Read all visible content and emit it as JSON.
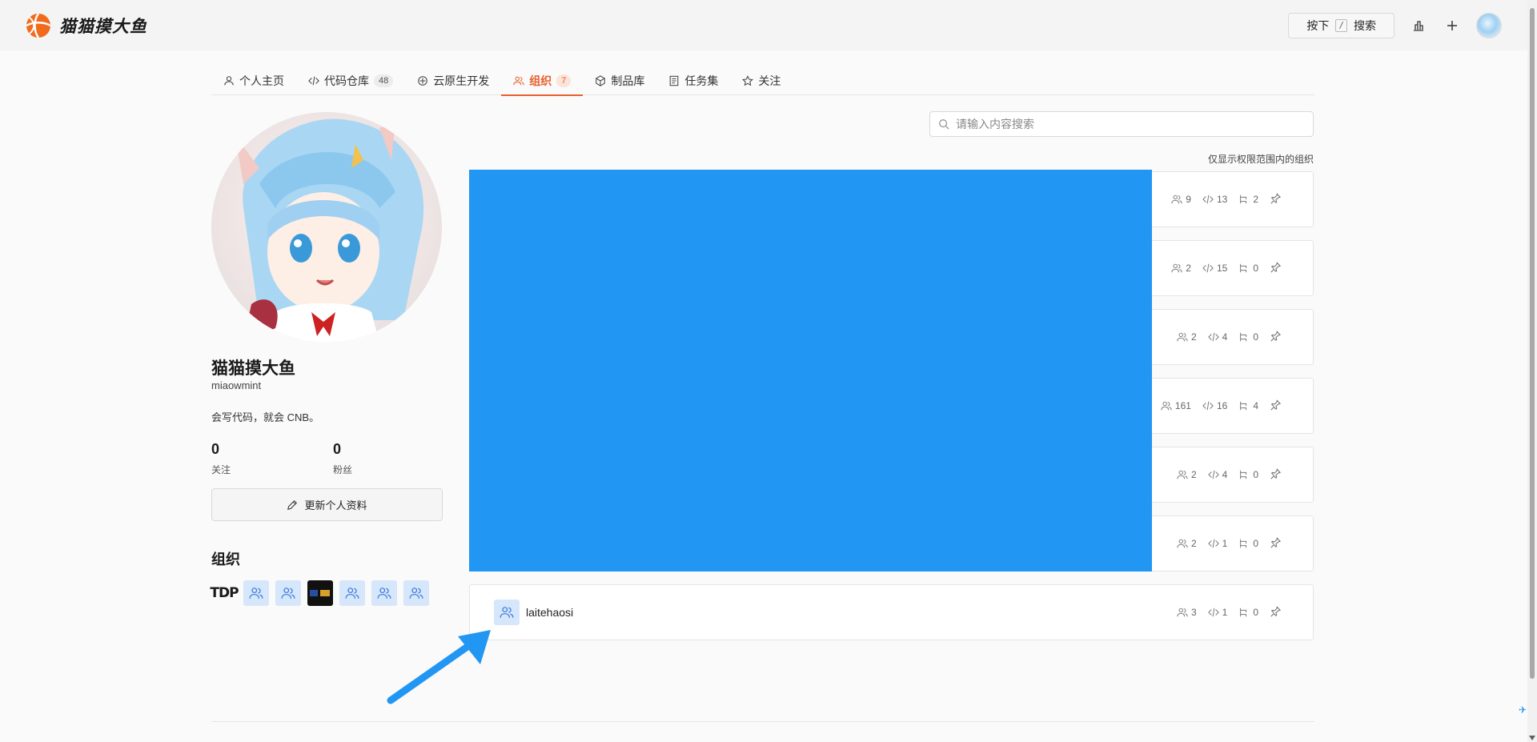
{
  "header": {
    "brand_name": "猫猫摸大鱼",
    "search_prefix": "按下",
    "search_key": "/",
    "search_label": "搜索"
  },
  "tabs": [
    {
      "label": "个人主页",
      "icon": "user-icon"
    },
    {
      "label": "代码仓库",
      "icon": "code-icon",
      "count": "48"
    },
    {
      "label": "云原生开发",
      "icon": "cloud-dev-icon"
    },
    {
      "label": "组织",
      "icon": "org-icon",
      "count": "7",
      "active": true
    },
    {
      "label": "制品库",
      "icon": "package-icon"
    },
    {
      "label": "任务集",
      "icon": "task-icon"
    },
    {
      "label": "关注",
      "icon": "star-icon"
    }
  ],
  "profile": {
    "display_name": "猫猫摸大鱼",
    "username": "miaowmint",
    "bio": "会写代码，就会 CNB。",
    "following_count": "0",
    "following_label": "关注",
    "followers_count": "0",
    "followers_label": "粉丝",
    "edit_button": "更新个人资料",
    "orgs_title": "组织",
    "org_badges": [
      "TDP",
      "org",
      "org",
      "dark-logo",
      "org",
      "org",
      "org"
    ]
  },
  "content": {
    "search_placeholder": "请输入内容搜索",
    "scope_note": "仅显示权限范围内的组织",
    "orgs": [
      {
        "name": "",
        "members": "9",
        "repos": "13",
        "sub": "2"
      },
      {
        "name": "",
        "members": "2",
        "repos": "15",
        "sub": "0"
      },
      {
        "name": "",
        "members": "2",
        "repos": "4",
        "sub": "0"
      },
      {
        "name": "",
        "members": "161",
        "repos": "16",
        "sub": "4"
      },
      {
        "name": "",
        "members": "2",
        "repos": "4",
        "sub": "0"
      },
      {
        "name": "",
        "members": "2",
        "repos": "1",
        "sub": "0"
      },
      {
        "name": "laitehaosi",
        "members": "3",
        "repos": "1",
        "sub": "0"
      }
    ]
  },
  "colors": {
    "accent": "#e8602c",
    "redaction_block": "#2196f3",
    "arrow": "#2196f3"
  }
}
